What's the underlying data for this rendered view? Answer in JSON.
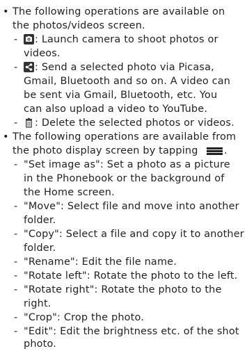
{
  "sections": [
    {
      "intro": [
        "The following operations are available on",
        "the photos/videos screen."
      ],
      "items": [
        {
          "icon": "camera-icon",
          "lines": [
            " : Launch camera to shoot photos or",
            "videos."
          ]
        },
        {
          "icon": "share-icon",
          "lines": [
            " : Send a selected photo via Picasa,",
            "Gmail, Bluetooth and so on. A video can",
            "be sent via Gmail, Bluetooth, etc. You",
            "can also upload a video to YouTube."
          ]
        },
        {
          "icon": "trash-icon",
          "lines": [
            " : Delete the selected photos or videos."
          ]
        }
      ]
    },
    {
      "intro": [
        "The following operations are available from",
        "the photo display screen by tapping",
        "."
      ],
      "items": [
        {
          "lines": [
            "\"Set image as\": Set a photo as a picture",
            "in the Phonebook or the background of",
            "the Home screen."
          ]
        },
        {
          "lines": [
            "\"Move\": Select file and move into another",
            "folder."
          ]
        },
        {
          "lines": [
            "\"Copy\": Select a file and copy it to another",
            "folder."
          ]
        },
        {
          "lines": [
            "\"Rename\": Edit the file name."
          ]
        },
        {
          "lines": [
            "\"Rotate left\": Rotate the photo to the left."
          ]
        },
        {
          "lines": [
            "\"Rotate right\": Rotate the photo to the",
            "right."
          ]
        },
        {
          "lines": [
            "\"Crop\": Crop the photo."
          ]
        },
        {
          "lines": [
            "\"Edit\": Edit the brightness etc. of the shot",
            "photo."
          ]
        }
      ]
    }
  ],
  "markers": {
    "bullet": "•",
    "dash": "-"
  }
}
